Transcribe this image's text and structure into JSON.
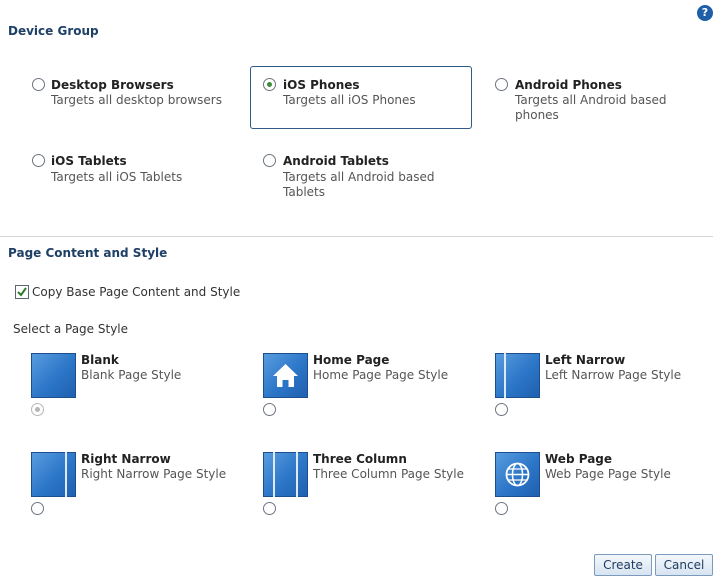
{
  "help": {
    "glyph": "?"
  },
  "device_group": {
    "title": "Device Group",
    "options": [
      {
        "title": "Desktop Browsers",
        "description": "Targets all desktop browsers",
        "selected": false
      },
      {
        "title": "iOS Phones",
        "description": "Targets all iOS Phones",
        "selected": true
      },
      {
        "title": "Android Phones",
        "description": "Targets all Android based phones",
        "selected": false
      },
      {
        "title": "iOS Tablets",
        "description": "Targets all iOS Tablets",
        "selected": false
      },
      {
        "title": "Android Tablets",
        "description": "Targets all Android based Tablets",
        "selected": false
      }
    ]
  },
  "page_content": {
    "title": "Page Content and Style",
    "copy_checkbox": {
      "label": "Copy Base Page Content and Style",
      "checked": true
    },
    "select_label": "Select a Page Style",
    "styles": [
      {
        "title": "Blank",
        "description": "Blank Page Style",
        "icon": "blank-page-icon",
        "selected": true,
        "disabled": true
      },
      {
        "title": "Home Page",
        "description": "Home Page Page Style",
        "icon": "home-icon",
        "selected": false,
        "disabled": false
      },
      {
        "title": "Left Narrow",
        "description": "Left Narrow Page Style",
        "icon": "left-narrow-layout-icon",
        "selected": false,
        "disabled": false
      },
      {
        "title": "Right Narrow",
        "description": "Right Narrow Page Style",
        "icon": "right-narrow-layout-icon",
        "selected": false,
        "disabled": false
      },
      {
        "title": "Three Column",
        "description": "Three Column Page Style",
        "icon": "three-column-layout-icon",
        "selected": false,
        "disabled": false
      },
      {
        "title": "Web Page",
        "description": "Web Page Page Style",
        "icon": "globe-icon",
        "selected": false,
        "disabled": false
      }
    ]
  },
  "buttons": {
    "create": "Create",
    "cancel": "Cancel"
  },
  "colors": {
    "accent": "#1e5fa8",
    "section_title": "#1e3f66",
    "selected_border": "#2f5b86",
    "radio_selected": "#3f8b3f"
  }
}
